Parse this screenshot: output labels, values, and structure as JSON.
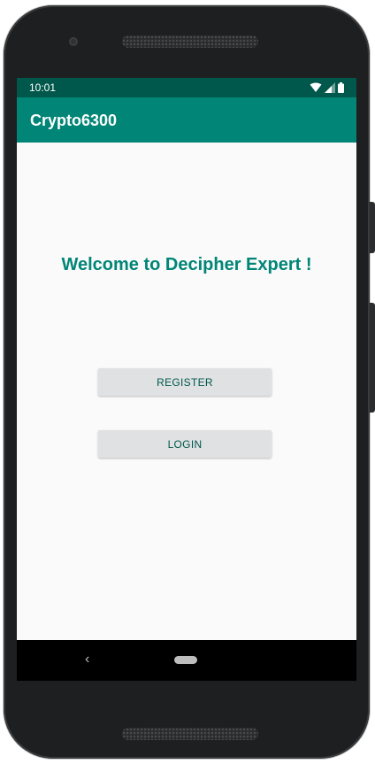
{
  "status_bar": {
    "time": "10:01",
    "icons": [
      "wifi-icon",
      "signal-icon",
      "battery-icon"
    ]
  },
  "app_bar": {
    "title": "Crypto6300"
  },
  "main": {
    "welcome_text": "Welcome to Decipher Expert !",
    "register_label": "REGISTER",
    "login_label": "LOGIN"
  },
  "nav_bar": {
    "back_glyph": "‹"
  },
  "colors": {
    "status_bar": "#00574b",
    "app_bar": "#008577",
    "accent_text": "#008577",
    "button_bg": "#dfe1e3",
    "button_text": "#00574b"
  }
}
